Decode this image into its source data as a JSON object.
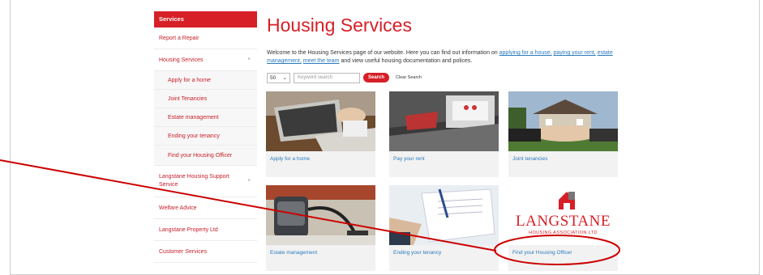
{
  "sidebar": {
    "header": "Services",
    "items": [
      {
        "label": "Report a Repair",
        "sub": false,
        "arrow": ""
      },
      {
        "label": "Housing Services",
        "sub": false,
        "arrow": "^"
      },
      {
        "label": "Apply for a home",
        "sub": true,
        "arrow": ""
      },
      {
        "label": "Joint Tenancies",
        "sub": true,
        "arrow": ""
      },
      {
        "label": "Estate management",
        "sub": true,
        "arrow": ""
      },
      {
        "label": "Ending your tenancy",
        "sub": true,
        "arrow": ""
      },
      {
        "label": "Find your Housing Officer",
        "sub": true,
        "arrow": ""
      },
      {
        "label": "Langstane Housing Support Service",
        "sub": false,
        "arrow": "v"
      },
      {
        "label": "Welfare Advice",
        "sub": false,
        "arrow": ""
      },
      {
        "label": "Langstane Property Ltd",
        "sub": false,
        "arrow": ""
      },
      {
        "label": "Customer Services",
        "sub": false,
        "arrow": ""
      }
    ]
  },
  "main": {
    "title": "Housing Services",
    "intro": {
      "prefix": "Welcome to the Housing Services page of our website. Here you can find out information on ",
      "link1": "applying for a house,",
      "link2": "paying your rent,",
      "link3": "estate management,",
      "link4": "meet the team",
      "suffix": " and view useful housing documentation and polices."
    },
    "search": {
      "page_size": "50",
      "placeholder": "Keyword search",
      "button": "Search",
      "clear": "Clear Search"
    },
    "cards": [
      {
        "label": "Apply for a home"
      },
      {
        "label": "Pay your rent"
      },
      {
        "label": "Joint tenancies"
      },
      {
        "label": "Estate management"
      },
      {
        "label": "Ending your tenancy"
      },
      {
        "label": "Find your Housing Officer"
      }
    ],
    "logo": {
      "name": "LANGSTANE",
      "tagline": "HOUSING ASSOCIATION LTD"
    }
  },
  "colors": {
    "brand_red": "#d61f26",
    "link_blue": "#2b7bbf",
    "annotation": "#cc0000"
  }
}
